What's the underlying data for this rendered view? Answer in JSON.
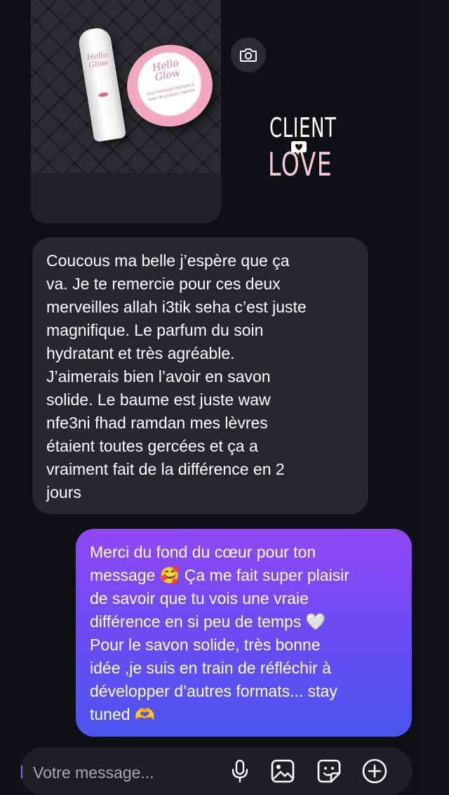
{
  "shared_photo": {
    "tube_brand": "Hello Glow",
    "jar_brand": "Hello Glow",
    "jar_subtext": "Soin Hydratant Parfumé à base de produits naturels"
  },
  "sticker": {
    "line1": "CLIENT",
    "line2": "LOVE"
  },
  "messages": [
    {
      "direction": "received",
      "text": "Coucous ma belle j’espère que ça\nva. Je te remercie pour ces deux\nmerveilles allah i3tik seha c’est juste\nmagnifique. Le parfum du soin\nhydratant et très agréable.\nJ’aimerais bien l’avoir en savon\nsolide. Le baume est juste waw\nnfe3ni fhad ramdan mes lèvres\nétaient toutes gercées et ça a\nvraiment fait de la différence en 2\njours"
    },
    {
      "direction": "sent",
      "text": "Merci du fond du cœur pour ton\nmessage 🥰 Ça me fait super plaisir\nde savoir que tu vois une vraie\ndifférence en si peu de temps 🤍\nPour le savon solide, très bonne\nidée ,je suis en train de réfléchir à\ndévelopper d’autres formats... stay\ntuned 🫶"
    }
  ],
  "composer": {
    "placeholder": "Votre message..."
  },
  "icons": {
    "camera": "camera-icon",
    "heart": "heart-icon",
    "microphone": "microphone-icon",
    "gallery": "image-icon",
    "sticker": "sticker-icon",
    "add": "plus-circle-icon"
  },
  "colors": {
    "background": "#0e1013",
    "received_bubble": "#26282d",
    "sent_gradient_top": "#9048f5",
    "sent_gradient_bottom": "#4b55ee",
    "composer": "#1d1f23"
  }
}
